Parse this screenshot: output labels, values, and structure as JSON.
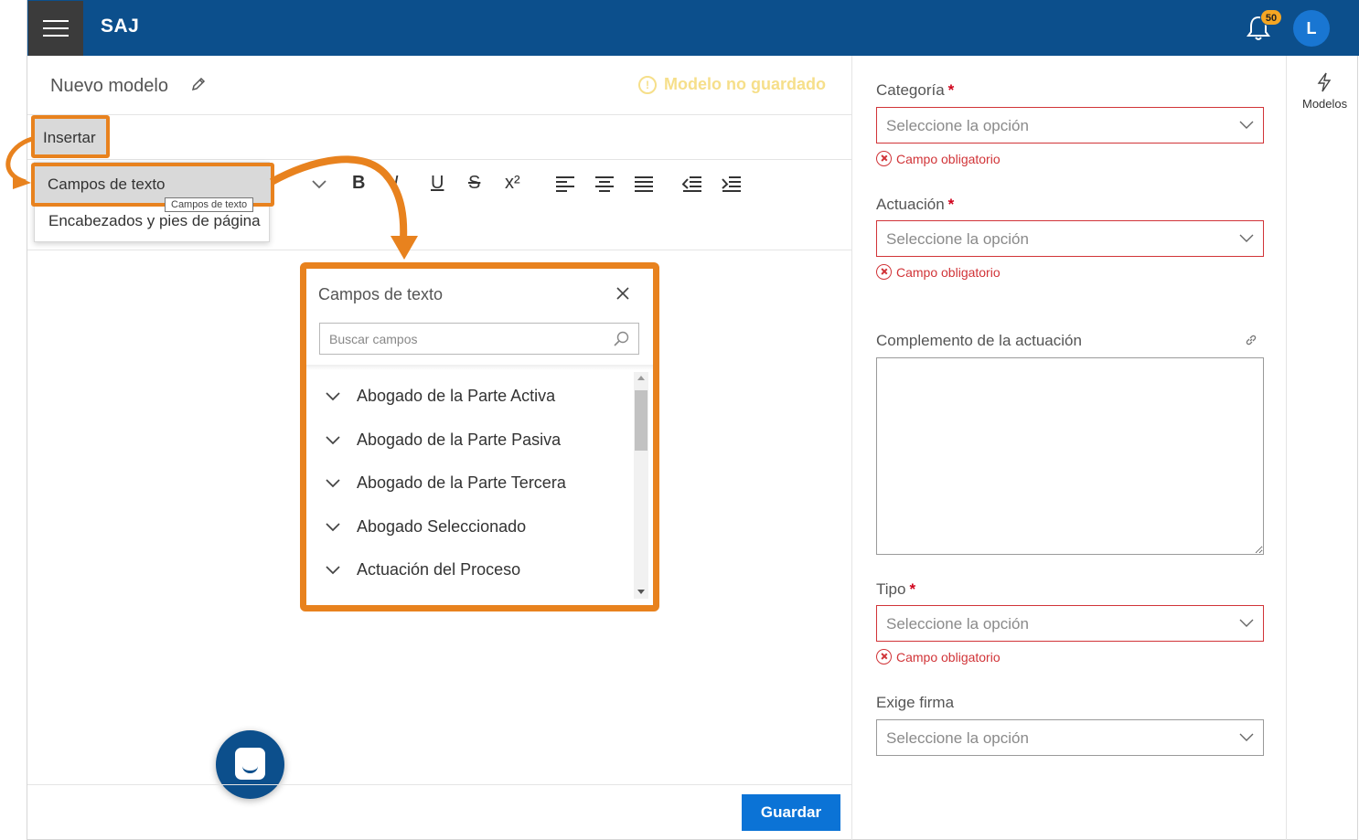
{
  "header": {
    "brand": "SAJ",
    "notification_count": "50",
    "avatar_initial": "L",
    "icons": [
      "menu-icon",
      "bell-icon"
    ]
  },
  "editor": {
    "title": "Nuevo modelo",
    "unsaved_label": "Modelo no guardado",
    "menu": {
      "insert_label": "Insertar"
    },
    "dropdown": {
      "items": [
        "Campos de texto",
        "Encabezados y pies de página"
      ],
      "tooltip": "Campos de texto"
    },
    "toolbar": {
      "bold": "B",
      "italic": "I",
      "underline": "U",
      "strike": "S",
      "superscript": "x²"
    },
    "fields_panel": {
      "title": "Campos de texto",
      "search_placeholder": "Buscar campos",
      "items": [
        "Abogado de la Parte Activa",
        "Abogado de la Parte Pasiva",
        "Abogado de la Parte Tercera",
        "Abogado Seleccionado",
        "Actuación del Proceso"
      ]
    },
    "save_label": "Guardar"
  },
  "form": {
    "categoria": {
      "label": "Categoría",
      "required": "*",
      "placeholder": "Seleccione la opción",
      "error": "Campo obligatorio"
    },
    "actuacion": {
      "label": "Actuación",
      "required": "*",
      "placeholder": "Seleccione la opción",
      "error": "Campo obligatorio"
    },
    "complemento": {
      "label": "Complemento de la actuación"
    },
    "tipo": {
      "label": "Tipo",
      "required": "*",
      "placeholder": "Seleccione la opción",
      "error": "Campo obligatorio"
    },
    "exige_firma": {
      "label": "Exige firma",
      "placeholder": "Seleccione la opción"
    }
  },
  "rail": {
    "label": "Modelos"
  },
  "colors": {
    "topbar": "#0c4f8c",
    "accent": "#e8821e",
    "error": "#d13438",
    "primary_button": "#0b73d6",
    "unsaved": "#f6df8a"
  }
}
